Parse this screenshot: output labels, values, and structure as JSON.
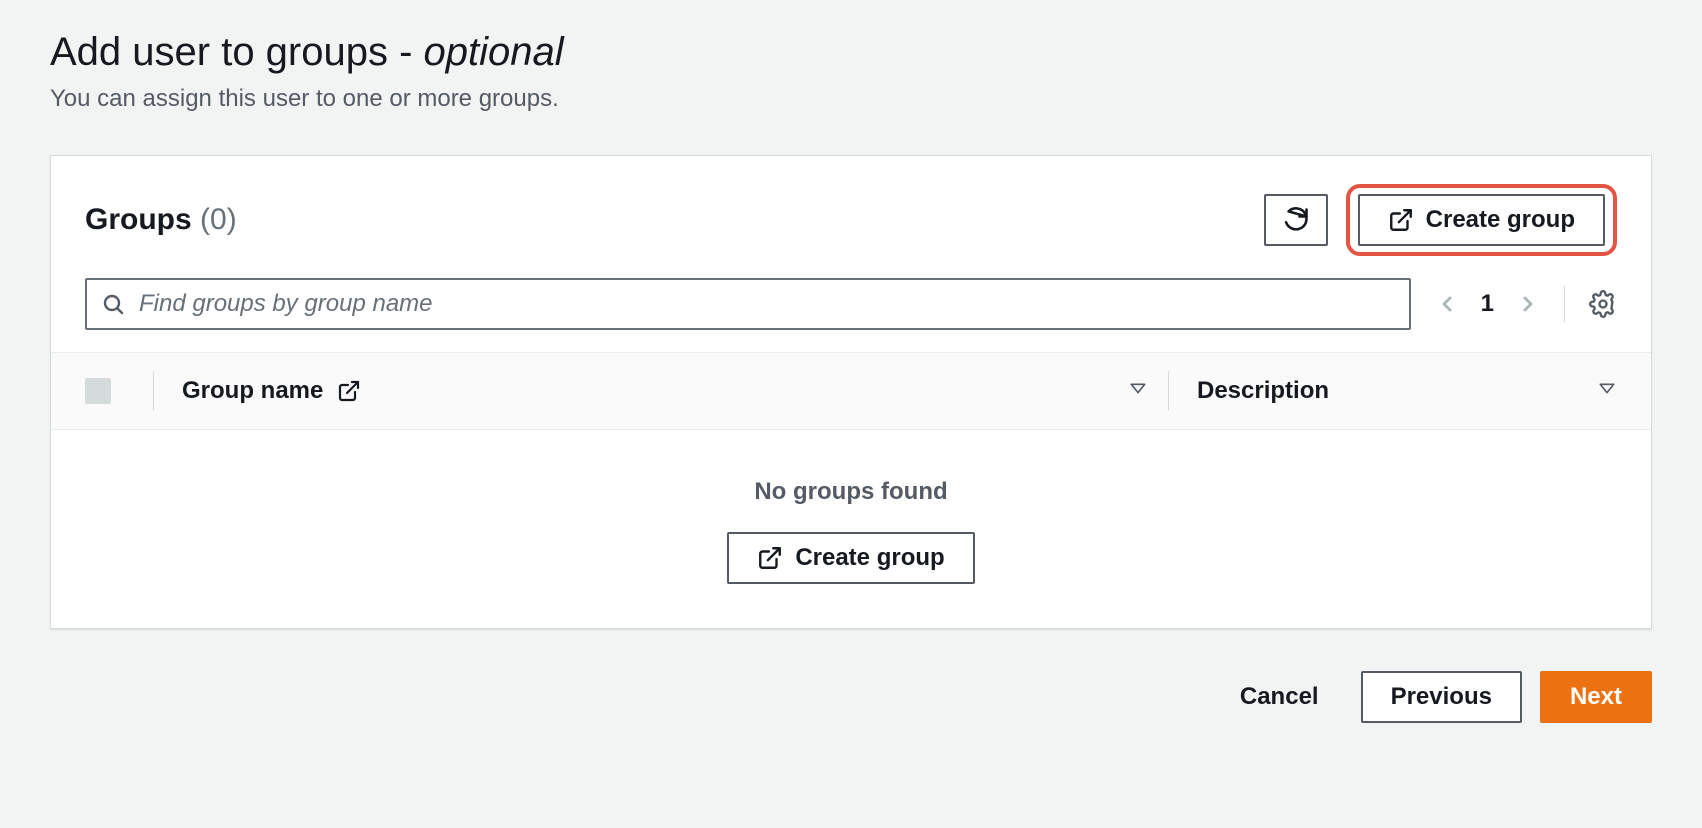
{
  "page": {
    "title_prefix": "Add user to groups",
    "title_separator": " - ",
    "title_suffix": "optional",
    "subtitle": "You can assign this user to one or more groups."
  },
  "panel": {
    "title": "Groups",
    "count": "(0)",
    "refresh_aria": "Refresh",
    "create_group_label": "Create group",
    "search_placeholder": "Find groups by group name",
    "page_number": "1"
  },
  "table": {
    "col_group_name": "Group name",
    "col_description": "Description",
    "empty_title": "No groups found",
    "empty_action": "Create group"
  },
  "footer": {
    "cancel": "Cancel",
    "previous": "Previous",
    "next": "Next"
  }
}
